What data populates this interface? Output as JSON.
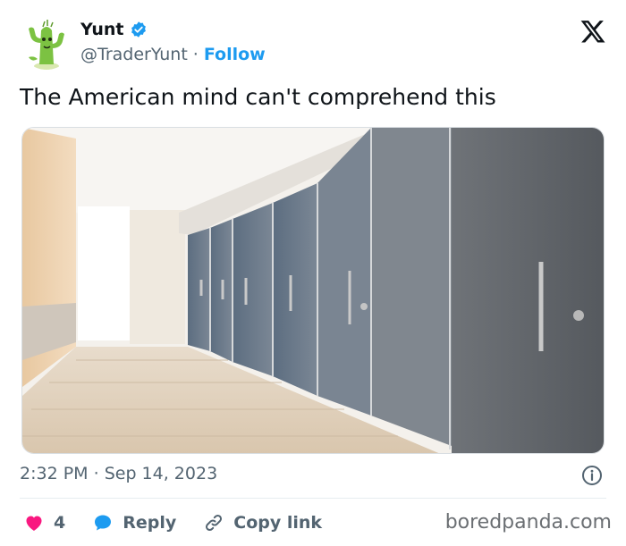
{
  "user": {
    "display_name": "Yunt",
    "handle": "@TraderYunt",
    "separator": "·",
    "follow_label": "Follow",
    "verified": true
  },
  "tweet": {
    "text": "The American mind can't comprehend this",
    "time": "2:32 PM",
    "date_separator": "·",
    "date": "Sep 14, 2023"
  },
  "actions": {
    "like_count": "4",
    "reply_label": "Reply",
    "copy_link_label": "Copy link"
  },
  "watermark": "boredpanda.com",
  "icons": {
    "verified": "verified-badge-icon",
    "x_logo": "x-logo-icon",
    "info": "info-icon",
    "like": "heart-icon",
    "reply": "speech-bubble-icon",
    "copy_link": "link-icon"
  },
  "colors": {
    "accent": "#1d9bf0",
    "like": "#f91880",
    "muted_text": "#536471"
  }
}
